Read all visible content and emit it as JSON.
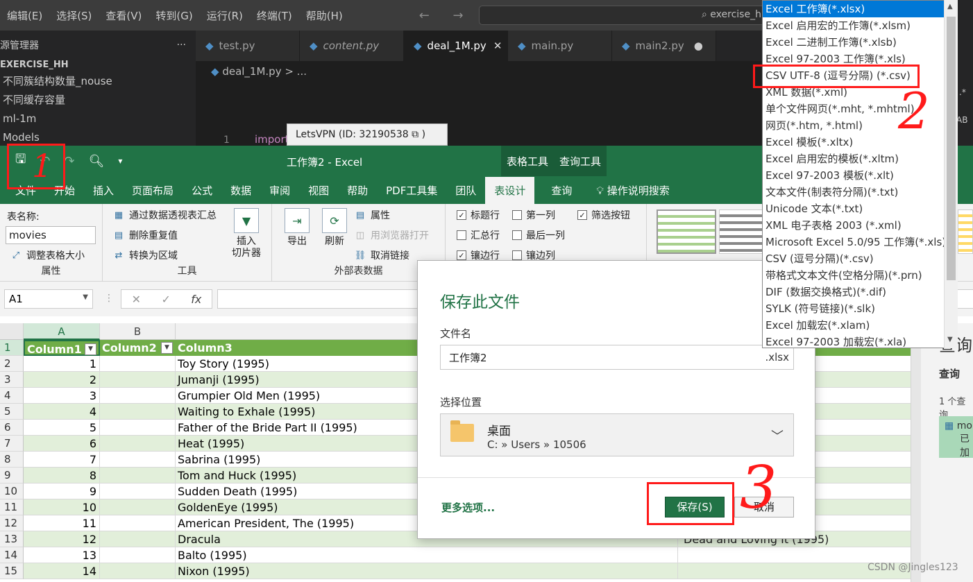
{
  "vscode": {
    "menu": [
      "编辑(E)",
      "选择(S)",
      "查看(V)",
      "转到(G)",
      "运行(R)",
      "终端(T)",
      "帮助(H)"
    ],
    "nav_arrows": "← →",
    "search_text": "exercise_h",
    "explorer": {
      "title": "源管理器",
      "more": "···",
      "root": "EXERCISE_HH",
      "items": [
        "不同簇结构数量_nouse",
        "不同缓存容量",
        "ml-1m",
        "Models"
      ]
    },
    "tabs": [
      {
        "label": "test.py",
        "active": false,
        "close": ""
      },
      {
        "label": "content.py",
        "active": false,
        "close": ""
      },
      {
        "label": "deal_1M.py",
        "active": true,
        "close": "✕"
      },
      {
        "label": "main.py",
        "active": false,
        "close": ""
      },
      {
        "label": "main2.py",
        "active": false,
        "close": "●"
      }
    ],
    "breadcrumb": "deal_1M.py > ...",
    "line_number": "1",
    "code_fragment": "import",
    "right_glyphs": [
      ".*",
      "AB"
    ]
  },
  "letsvpn": "LetsVPN (ID:  32190538 ⧉ )",
  "excel": {
    "title": "工作簿2  -  Excel",
    "context_tabs": [
      "表格工具",
      "查询工具"
    ],
    "ribbon_tabs": [
      {
        "label": "文件",
        "active": false
      },
      {
        "label": "开始",
        "active": false
      },
      {
        "label": "插入",
        "active": false
      },
      {
        "label": "页面布局",
        "active": false
      },
      {
        "label": "公式",
        "active": false
      },
      {
        "label": "数据",
        "active": false
      },
      {
        "label": "审阅",
        "active": false
      },
      {
        "label": "视图",
        "active": false
      },
      {
        "label": "帮助",
        "active": false
      },
      {
        "label": "PDF工具集",
        "active": false
      },
      {
        "label": "团队",
        "active": false
      },
      {
        "label": "表设计",
        "active": true
      },
      {
        "label": "查询",
        "active": false
      }
    ],
    "tell_me": "操作说明搜索",
    "ribbon": {
      "properties": {
        "table_name_label": "表名称:",
        "table_name_value": "movies",
        "resize": "调整表格大小",
        "group": "属性"
      },
      "tools": {
        "pivot": "通过数据透视表汇总",
        "dedupe": "删除重复值",
        "convert": "转换为区域",
        "slicer": "插入\n切片器",
        "group": "工具"
      },
      "external": {
        "export": "导出",
        "refresh": "刷新",
        "props": "属性",
        "open_browser": "用浏览器打开",
        "unlink": "取消链接",
        "group": "外部表数据"
      },
      "style_options": [
        {
          "label": "标题行",
          "checked": true
        },
        {
          "label": "第一列",
          "checked": false
        },
        {
          "label": "筛选按钮",
          "checked": true
        },
        {
          "label": "汇总行",
          "checked": false
        },
        {
          "label": "最后一列",
          "checked": false
        },
        {
          "label": "镶边行",
          "checked": true
        },
        {
          "label": "镶边列",
          "checked": false
        }
      ]
    },
    "namebox": "A1",
    "fx_icons": [
      "✕",
      "✓",
      "fx"
    ],
    "columns": [
      "A",
      "B"
    ],
    "header_row": [
      "Column1",
      "Column2",
      "Column3"
    ],
    "rows": [
      {
        "n": "2",
        "id": "1",
        "title": "Toy Story (1995)",
        "extra": ""
      },
      {
        "n": "3",
        "id": "2",
        "title": "Jumanji (1995)",
        "extra": ""
      },
      {
        "n": "4",
        "id": "3",
        "title": "Grumpier Old Men (1995)",
        "extra": ""
      },
      {
        "n": "5",
        "id": "4",
        "title": "Waiting to Exhale (1995)",
        "extra": ""
      },
      {
        "n": "6",
        "id": "5",
        "title": "Father of the Bride Part II (1995)",
        "extra": ""
      },
      {
        "n": "7",
        "id": "6",
        "title": "Heat (1995)",
        "extra": ""
      },
      {
        "n": "8",
        "id": "7",
        "title": "Sabrina (1995)",
        "extra": ""
      },
      {
        "n": "9",
        "id": "8",
        "title": "Tom and Huck (1995)",
        "extra": ""
      },
      {
        "n": "10",
        "id": "9",
        "title": "Sudden Death (1995)",
        "extra": ""
      },
      {
        "n": "11",
        "id": "10",
        "title": "GoldenEye (1995)",
        "extra": ""
      },
      {
        "n": "12",
        "id": "11",
        "title": "American President, The (1995)",
        "extra": ""
      },
      {
        "n": "13",
        "id": "12",
        "title": "Dracula",
        "extra": "Dead and Loving It (1995)"
      },
      {
        "n": "14",
        "id": "13",
        "title": "Balto (1995)",
        "extra": ""
      },
      {
        "n": "15",
        "id": "14",
        "title": "Nixon (1995)",
        "extra": ""
      }
    ],
    "query_pane": {
      "title": "查询",
      "tab": "查询",
      "count": "1 个查询",
      "card_name": "mo",
      "card_status": "已加"
    }
  },
  "save_dialog": {
    "title": "保存此文件",
    "filename_label": "文件名",
    "filename": "工作簿2",
    "extension": ".xlsx",
    "location_label": "选择位置",
    "location_name": "桌面",
    "location_path": "C: » Users » 10506",
    "more_options": "更多选项...",
    "save": "保存(S)",
    "cancel": "取消"
  },
  "filetypes": [
    {
      "label": "Excel 工作簿(*.xlsx)",
      "selected": true
    },
    {
      "label": "Excel 启用宏的工作簿(*.xlsm)",
      "selected": false
    },
    {
      "label": "Excel 二进制工作簿(*.xlsb)",
      "selected": false
    },
    {
      "label": "Excel 97-2003 工作簿(*.xls)",
      "selected": false
    },
    {
      "label": "CSV UTF-8 (逗号分隔) (*.csv)",
      "selected": false
    },
    {
      "label": "XML 数据(*.xml)",
      "selected": false
    },
    {
      "label": "单个文件网页(*.mht, *.mhtml)",
      "selected": false
    },
    {
      "label": "网页(*.htm, *.html)",
      "selected": false
    },
    {
      "label": "Excel 模板(*.xltx)",
      "selected": false
    },
    {
      "label": "Excel 启用宏的模板(*.xltm)",
      "selected": false
    },
    {
      "label": "Excel 97-2003 模板(*.xlt)",
      "selected": false
    },
    {
      "label": "文本文件(制表符分隔)(*.txt)",
      "selected": false
    },
    {
      "label": "Unicode 文本(*.txt)",
      "selected": false
    },
    {
      "label": "XML 电子表格 2003 (*.xml)",
      "selected": false
    },
    {
      "label": "Microsoft Excel 5.0/95 工作簿(*.xls)",
      "selected": false
    },
    {
      "label": "CSV (逗号分隔)(*.csv)",
      "selected": false
    },
    {
      "label": "带格式文本文件(空格分隔)(*.prn)",
      "selected": false
    },
    {
      "label": "DIF (数据交换格式)(*.dif)",
      "selected": false
    },
    {
      "label": "SYLK (符号链接)(*.slk)",
      "selected": false
    },
    {
      "label": "Excel 加载宏(*.xlam)",
      "selected": false
    },
    {
      "label": "Excel 97-2003 加载宏(*.xla)",
      "selected": false
    }
  ],
  "annotations": [
    "1",
    "2",
    "3"
  ],
  "watermark": "CSDN @Jingles123",
  "colors": {
    "excel_green": "#217346",
    "header_green": "#70ad47",
    "band": "#e2efda",
    "highlight": "#ff1a1a",
    "select_blue": "#0078d7"
  }
}
